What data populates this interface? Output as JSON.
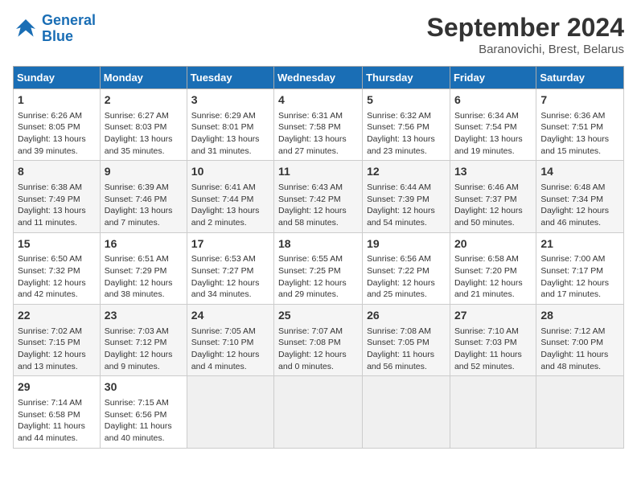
{
  "logo": {
    "line1": "General",
    "line2": "Blue"
  },
  "title": "September 2024",
  "location": "Baranovichi, Brest, Belarus",
  "days_of_week": [
    "Sunday",
    "Monday",
    "Tuesday",
    "Wednesday",
    "Thursday",
    "Friday",
    "Saturday"
  ],
  "weeks": [
    [
      {
        "day": "1",
        "sunrise": "6:26 AM",
        "sunset": "8:05 PM",
        "daylight": "13 hours and 39 minutes."
      },
      {
        "day": "2",
        "sunrise": "6:27 AM",
        "sunset": "8:03 PM",
        "daylight": "13 hours and 35 minutes."
      },
      {
        "day": "3",
        "sunrise": "6:29 AM",
        "sunset": "8:01 PM",
        "daylight": "13 hours and 31 minutes."
      },
      {
        "day": "4",
        "sunrise": "6:31 AM",
        "sunset": "7:58 PM",
        "daylight": "13 hours and 27 minutes."
      },
      {
        "day": "5",
        "sunrise": "6:32 AM",
        "sunset": "7:56 PM",
        "daylight": "13 hours and 23 minutes."
      },
      {
        "day": "6",
        "sunrise": "6:34 AM",
        "sunset": "7:54 PM",
        "daylight": "13 hours and 19 minutes."
      },
      {
        "day": "7",
        "sunrise": "6:36 AM",
        "sunset": "7:51 PM",
        "daylight": "13 hours and 15 minutes."
      }
    ],
    [
      {
        "day": "8",
        "sunrise": "6:38 AM",
        "sunset": "7:49 PM",
        "daylight": "13 hours and 11 minutes."
      },
      {
        "day": "9",
        "sunrise": "6:39 AM",
        "sunset": "7:46 PM",
        "daylight": "13 hours and 7 minutes."
      },
      {
        "day": "10",
        "sunrise": "6:41 AM",
        "sunset": "7:44 PM",
        "daylight": "13 hours and 2 minutes."
      },
      {
        "day": "11",
        "sunrise": "6:43 AM",
        "sunset": "7:42 PM",
        "daylight": "12 hours and 58 minutes."
      },
      {
        "day": "12",
        "sunrise": "6:44 AM",
        "sunset": "7:39 PM",
        "daylight": "12 hours and 54 minutes."
      },
      {
        "day": "13",
        "sunrise": "6:46 AM",
        "sunset": "7:37 PM",
        "daylight": "12 hours and 50 minutes."
      },
      {
        "day": "14",
        "sunrise": "6:48 AM",
        "sunset": "7:34 PM",
        "daylight": "12 hours and 46 minutes."
      }
    ],
    [
      {
        "day": "15",
        "sunrise": "6:50 AM",
        "sunset": "7:32 PM",
        "daylight": "12 hours and 42 minutes."
      },
      {
        "day": "16",
        "sunrise": "6:51 AM",
        "sunset": "7:29 PM",
        "daylight": "12 hours and 38 minutes."
      },
      {
        "day": "17",
        "sunrise": "6:53 AM",
        "sunset": "7:27 PM",
        "daylight": "12 hours and 34 minutes."
      },
      {
        "day": "18",
        "sunrise": "6:55 AM",
        "sunset": "7:25 PM",
        "daylight": "12 hours and 29 minutes."
      },
      {
        "day": "19",
        "sunrise": "6:56 AM",
        "sunset": "7:22 PM",
        "daylight": "12 hours and 25 minutes."
      },
      {
        "day": "20",
        "sunrise": "6:58 AM",
        "sunset": "7:20 PM",
        "daylight": "12 hours and 21 minutes."
      },
      {
        "day": "21",
        "sunrise": "7:00 AM",
        "sunset": "7:17 PM",
        "daylight": "12 hours and 17 minutes."
      }
    ],
    [
      {
        "day": "22",
        "sunrise": "7:02 AM",
        "sunset": "7:15 PM",
        "daylight": "12 hours and 13 minutes."
      },
      {
        "day": "23",
        "sunrise": "7:03 AM",
        "sunset": "7:12 PM",
        "daylight": "12 hours and 9 minutes."
      },
      {
        "day": "24",
        "sunrise": "7:05 AM",
        "sunset": "7:10 PM",
        "daylight": "12 hours and 4 minutes."
      },
      {
        "day": "25",
        "sunrise": "7:07 AM",
        "sunset": "7:08 PM",
        "daylight": "12 hours and 0 minutes."
      },
      {
        "day": "26",
        "sunrise": "7:08 AM",
        "sunset": "7:05 PM",
        "daylight": "11 hours and 56 minutes."
      },
      {
        "day": "27",
        "sunrise": "7:10 AM",
        "sunset": "7:03 PM",
        "daylight": "11 hours and 52 minutes."
      },
      {
        "day": "28",
        "sunrise": "7:12 AM",
        "sunset": "7:00 PM",
        "daylight": "11 hours and 48 minutes."
      }
    ],
    [
      {
        "day": "29",
        "sunrise": "7:14 AM",
        "sunset": "6:58 PM",
        "daylight": "11 hours and 44 minutes."
      },
      {
        "day": "30",
        "sunrise": "7:15 AM",
        "sunset": "6:56 PM",
        "daylight": "11 hours and 40 minutes."
      },
      null,
      null,
      null,
      null,
      null
    ]
  ]
}
